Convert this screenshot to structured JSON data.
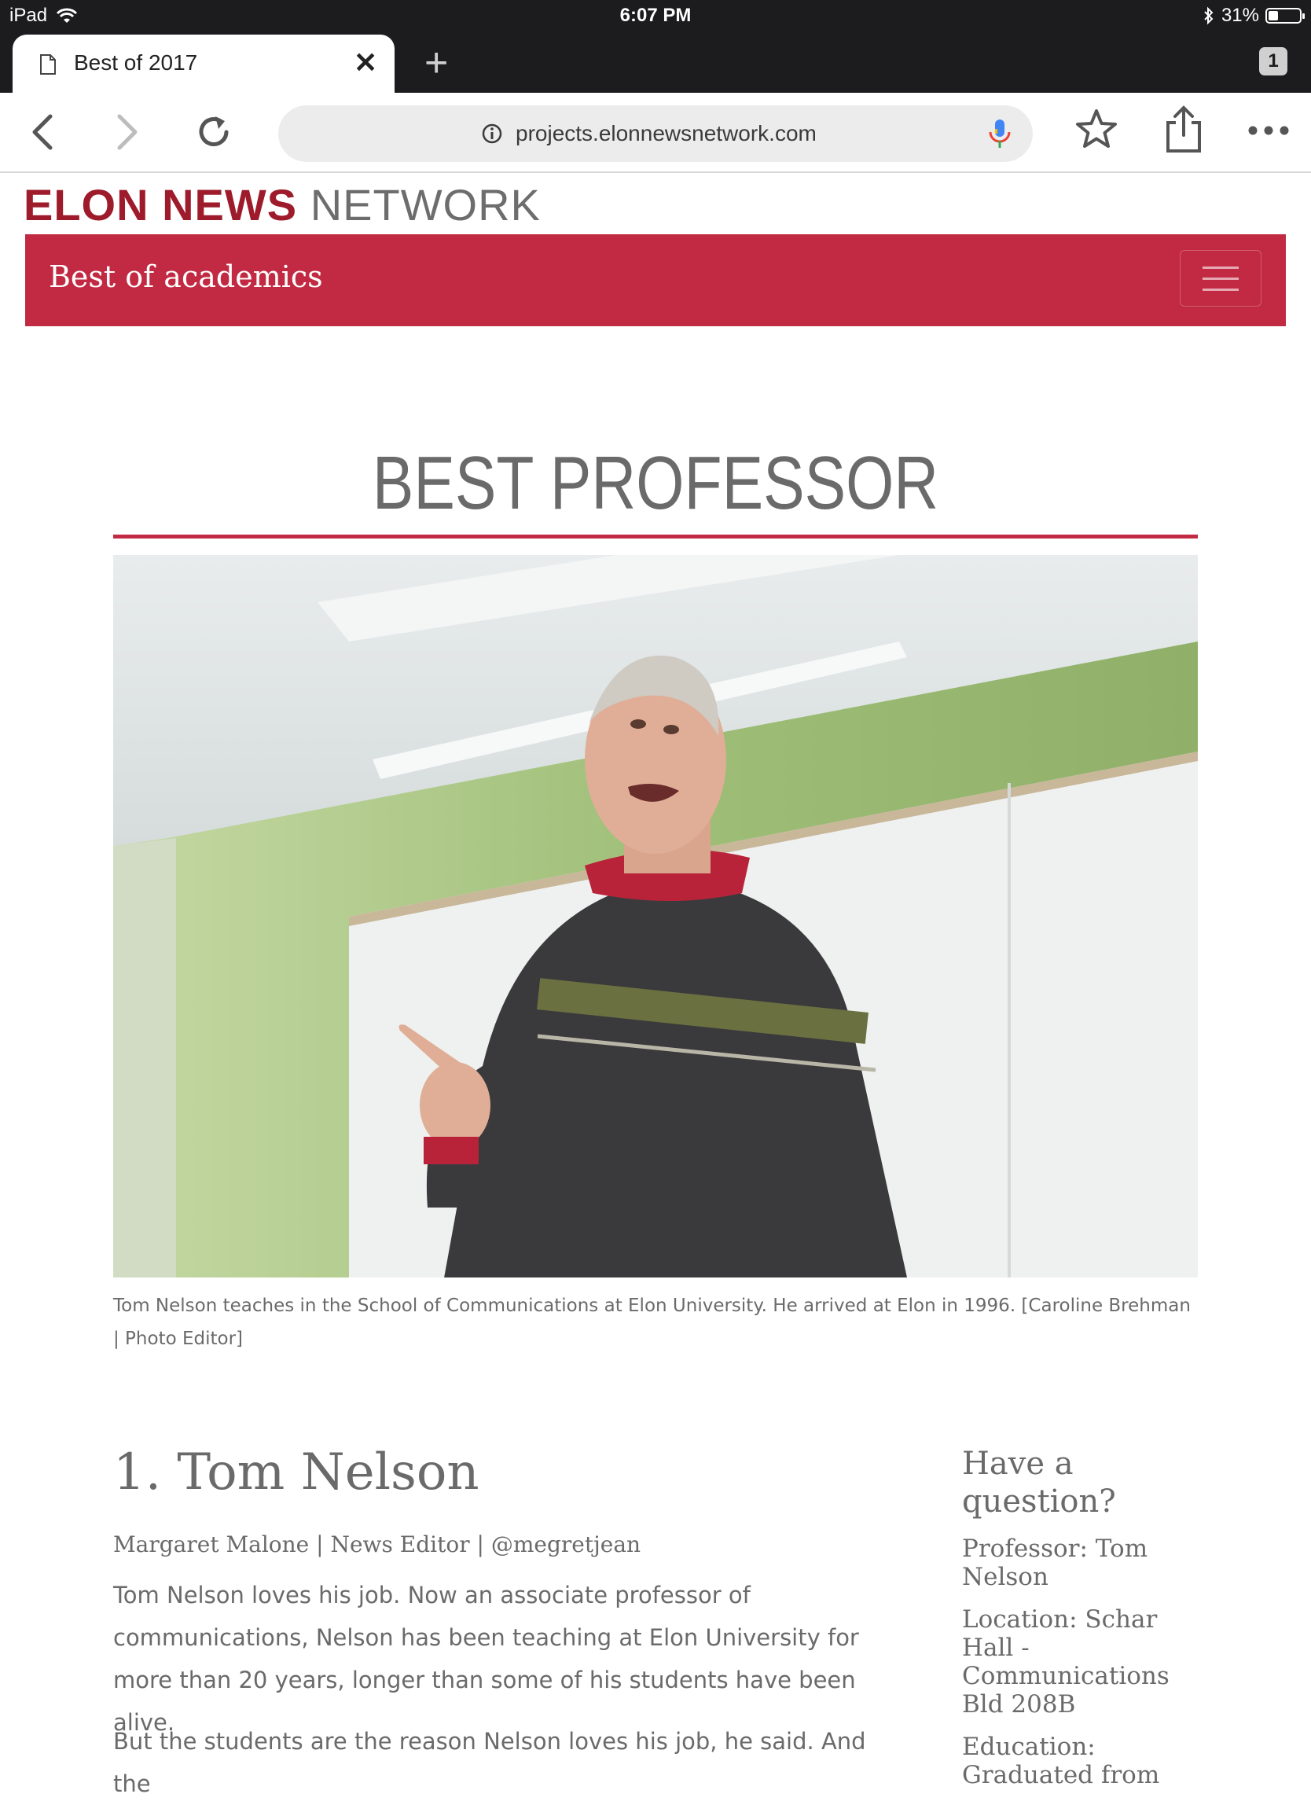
{
  "status_bar": {
    "device": "iPad",
    "time": "6:07 PM",
    "battery": "31%",
    "battery_level": 0.31
  },
  "browser": {
    "tab_title": "Best of 2017",
    "tab_count": "1",
    "url": "projects.elonnewsnetwork.com"
  },
  "site": {
    "brand_bold": "ELON NEWS",
    "brand_light": "NETWORK",
    "nav_title": "Best of academics"
  },
  "article": {
    "heading": "BEST PROFESSOR",
    "photo_caption": "Tom Nelson teaches in the School of Communications at Elon University. He arrived at Elon in 1996. [Caroline Brehman | Photo Editor]",
    "title": "1. Tom Nelson",
    "byline": "Margaret Malone | News Editor | @megretjean",
    "paragraphs": [
      "Tom Nelson loves his job. Now an associate professor of communications, Nelson has been teaching at Elon University for more than 20 years, longer than some of his students have been alive.",
      "But the students are the reason Nelson loves his job, he said. And the"
    ]
  },
  "sidebar": {
    "heading": "Have a question?",
    "professor": "Professor: Tom Nelson",
    "location": "Location: Schar Hall - Communications Bld 208B",
    "education": "Education: Graduated from"
  },
  "colors": {
    "accent": "#c12a42",
    "brand_red": "#9e1b2c",
    "text_gray": "#6a6a6a"
  }
}
